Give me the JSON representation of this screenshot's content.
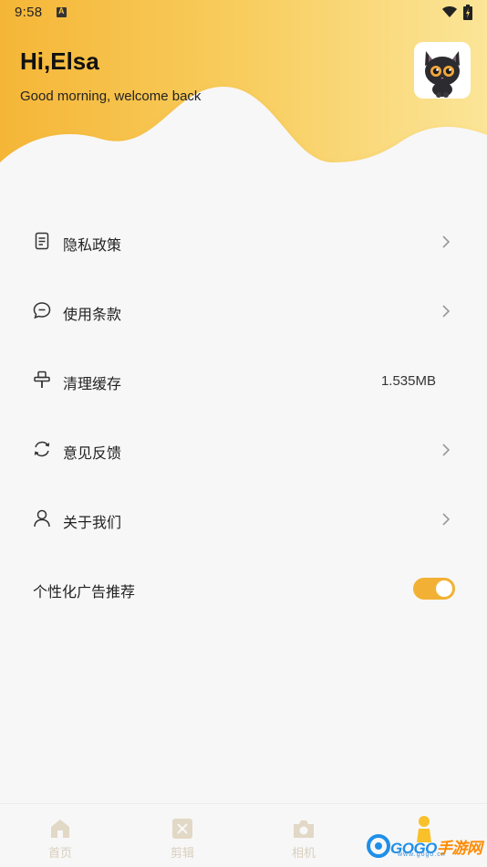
{
  "status_bar": {
    "time": "9:58"
  },
  "header": {
    "greeting": "Hi,Elsa",
    "subtitle": "Good morning, welcome back"
  },
  "menu": {
    "items": [
      {
        "label": "隐私政策",
        "icon": "document-icon",
        "has_chevron": true
      },
      {
        "label": "使用条款",
        "icon": "chat-bubble-icon",
        "has_chevron": true
      },
      {
        "label": "清理缓存",
        "icon": "brush-icon",
        "value": "1.535MB"
      },
      {
        "label": "意见反馈",
        "icon": "refresh-icon",
        "has_chevron": true
      },
      {
        "label": "关于我们",
        "icon": "user-icon",
        "has_chevron": true
      }
    ]
  },
  "ads": {
    "label": "个性化广告推荐",
    "enabled": true
  },
  "bottom_nav": {
    "items": [
      {
        "label": "首页",
        "icon": "home-icon"
      },
      {
        "label": "剪辑",
        "icon": "clip-icon"
      },
      {
        "label": "相机",
        "icon": "camera-icon"
      }
    ]
  },
  "watermark": {
    "brand_a": "GOGO",
    "brand_b": "手游网",
    "domain": "www.gogo.cn"
  },
  "colors": {
    "accent": "#f2b134",
    "header_gradient_start": "#f6b93a",
    "header_gradient_end": "#fbe79a"
  }
}
